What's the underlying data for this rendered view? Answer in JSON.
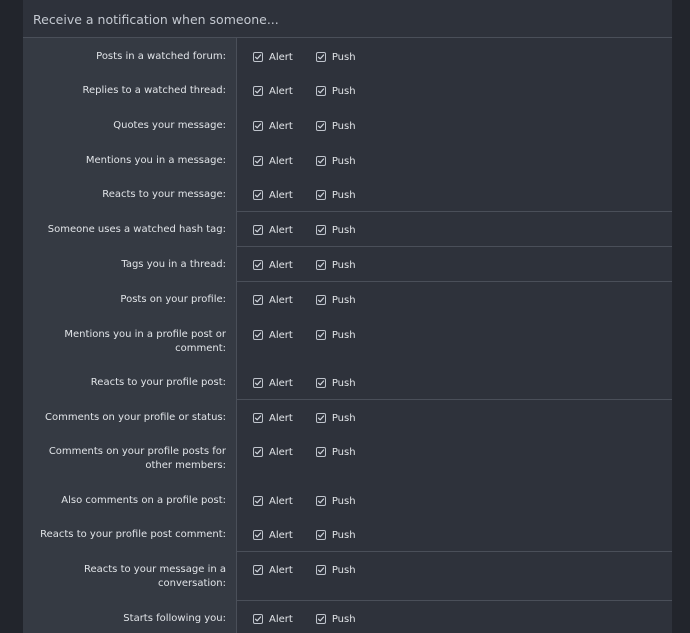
{
  "header": {
    "title": "Receive a notification when someone..."
  },
  "options": {
    "alert_label": "Alert",
    "push_label": "Push"
  },
  "rows": [
    {
      "label": "Posts in a watched forum:",
      "alert": true,
      "push": true
    },
    {
      "label": "Replies to a watched thread:",
      "alert": true,
      "push": true
    },
    {
      "label": "Quotes your message:",
      "alert": true,
      "push": true
    },
    {
      "label": "Mentions you in a message:",
      "alert": true,
      "push": true
    },
    {
      "label": "Reacts to your message:",
      "alert": true,
      "push": true
    },
    {
      "label": "Someone uses a watched hash tag:",
      "alert": true,
      "push": true
    },
    {
      "label": "Tags you in a thread:",
      "alert": true,
      "push": true
    },
    {
      "label": "Posts on your profile:",
      "alert": true,
      "push": true
    },
    {
      "label": "Mentions you in a profile post or comment:",
      "alert": true,
      "push": true
    },
    {
      "label": "Reacts to your profile post:",
      "alert": true,
      "push": true
    },
    {
      "label": "Comments on your profile or status:",
      "alert": true,
      "push": true
    },
    {
      "label": "Comments on your profile posts for other members:",
      "alert": true,
      "push": true
    },
    {
      "label": "Also comments on a profile post:",
      "alert": true,
      "push": true
    },
    {
      "label": "Reacts to your profile post comment:",
      "alert": true,
      "push": true
    },
    {
      "label": "Reacts to your message in a conversation:",
      "alert": true,
      "push": true
    },
    {
      "label": "Starts following you:",
      "alert": true,
      "push": true
    }
  ]
}
